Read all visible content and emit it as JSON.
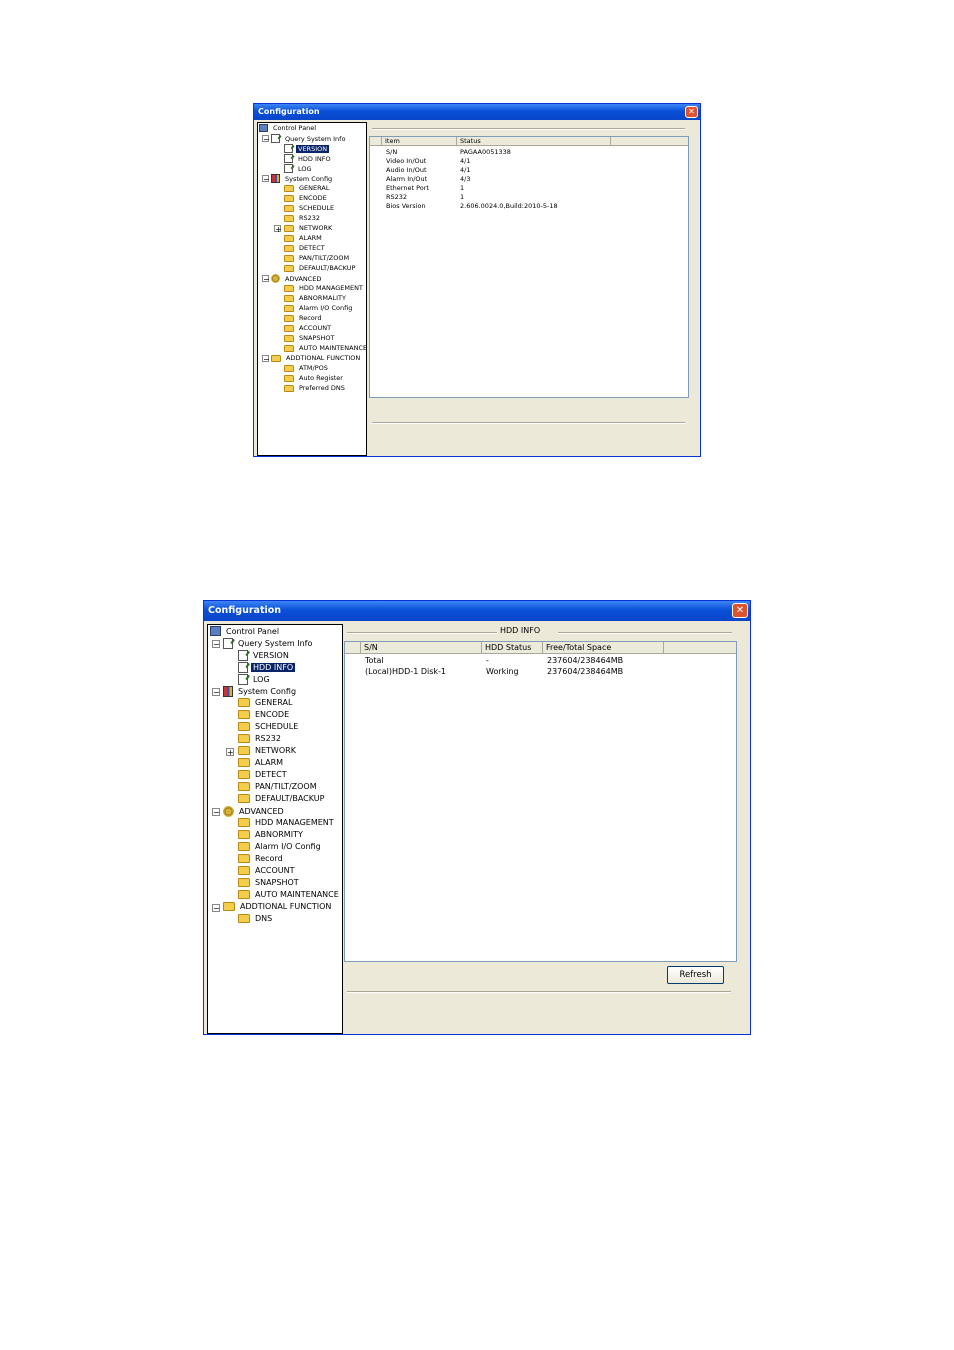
{
  "window1": {
    "title": "Configuration",
    "tree": {
      "root": "Control Panel",
      "query": "Query System Info",
      "version": "VERSION",
      "hdd_info": "HDD INFO",
      "log": "LOG",
      "system": "System Config",
      "general": "GENERAL",
      "encode": "ENCODE",
      "schedule": "SCHEDULE",
      "rs232": "RS232",
      "network": "NETWORK",
      "alarm": "ALARM",
      "detect": "DETECT",
      "ptz": "PAN/TILT/ZOOM",
      "backup": "DEFAULT/BACKUP",
      "advanced": "ADVANCED",
      "hdd_mgmt": "HDD MANAGEMENT",
      "abnormality": "ABNORMALITY",
      "alarm_io": "Alarm I/O Config",
      "record": "Record",
      "account": "ACCOUNT",
      "snapshot": "SNAPSHOT",
      "auto_maint": "AUTO MAINTENANCE",
      "additional": "ADDTIONAL FUNCTION",
      "atm": "ATM/POS",
      "auto_reg": "Auto Register",
      "pref_dns": "Preferred DNS"
    },
    "table": {
      "col_item": "Item",
      "col_status": "Status",
      "rows": [
        {
          "item": "S/N",
          "status": "PAGAA0051338"
        },
        {
          "item": "Video In/Out",
          "status": "4/1"
        },
        {
          "item": "Audio In/Out",
          "status": "4/1"
        },
        {
          "item": "Alarm In/Out",
          "status": "4/3"
        },
        {
          "item": "Ethernet Port",
          "status": "1"
        },
        {
          "item": "RS232",
          "status": "1"
        },
        {
          "item": "Bios Version",
          "status": "2.606.0024.0,Build:2010-5-18"
        }
      ]
    }
  },
  "window2": {
    "title": "Configuration",
    "tree": {
      "root": "Control Panel",
      "query": "Query System Info",
      "version": "VERSION",
      "hdd_info": "HDD INFO",
      "log": "LOG",
      "system": "System Config",
      "general": "GENERAL",
      "encode": "ENCODE",
      "schedule": "SCHEDULE",
      "rs232": "RS232",
      "network": "NETWORK",
      "alarm": "ALARM",
      "detect": "DETECT",
      "ptz": "PAN/TILT/ZOOM",
      "backup": "DEFAULT/BACKUP",
      "advanced": "ADVANCED",
      "hdd_mgmt": "HDD MANAGEMENT",
      "abnormity": "ABNORMITY",
      "alarm_io": "Alarm I/O Config",
      "record": "Record",
      "account": "ACCOUNT",
      "snapshot": "SNAPSHOT",
      "auto_maint": "AUTO MAINTENANCE",
      "additional": "ADDTIONAL FUNCTION",
      "dns": "DNS"
    },
    "section_title": "HDD INFO",
    "table": {
      "col_sn": "S/N",
      "col_status": "HDD Status",
      "col_space": "Free/Total Space",
      "rows": [
        {
          "sn": "Total",
          "status": "-",
          "space": "237604/238464MB"
        },
        {
          "sn": "(Local)HDD-1 Disk-1",
          "status": "Working",
          "space": "237604/238464MB"
        }
      ]
    },
    "refresh_label": "Refresh"
  }
}
